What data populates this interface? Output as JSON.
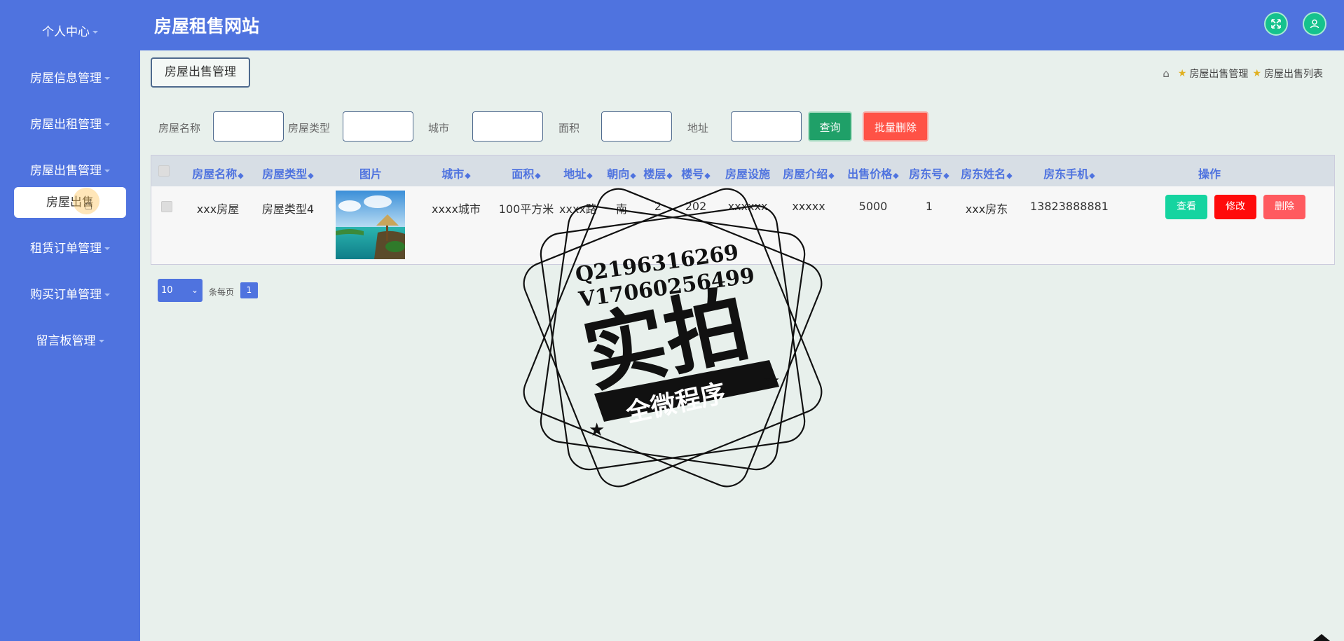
{
  "app": {
    "title": "房屋租售网站"
  },
  "sidebar": {
    "items": [
      {
        "label": "个人中心"
      },
      {
        "label": "房屋信息管理"
      },
      {
        "label": "房屋出租管理"
      },
      {
        "label": "房屋出售管理"
      },
      {
        "label": "租赁订单管理"
      },
      {
        "label": "购买订单管理"
      },
      {
        "label": "留言板管理"
      }
    ],
    "active_sub": "房屋出售"
  },
  "header": {
    "fullscreen_icon": "expand-icon",
    "user_icon": "user-icon"
  },
  "page": {
    "tab": "房屋出售管理",
    "breadcrumb": [
      "房屋出售管理",
      "房屋出售列表"
    ]
  },
  "search": {
    "fields": [
      {
        "label": "房屋名称",
        "value": ""
      },
      {
        "label": "房屋类型",
        "value": ""
      },
      {
        "label": "城市",
        "value": ""
      },
      {
        "label": "面积",
        "value": ""
      },
      {
        "label": "地址",
        "value": ""
      }
    ],
    "query_label": "查询",
    "batch_delete_label": "批量删除"
  },
  "table": {
    "columns": [
      "房屋名称",
      "房屋类型",
      "图片",
      "城市",
      "面积",
      "地址",
      "朝向",
      "楼层",
      "楼号",
      "房屋设施",
      "房屋介绍",
      "出售价格",
      "房东号",
      "房东姓名",
      "房东手机",
      "操作"
    ],
    "sortable": [
      true,
      true,
      false,
      true,
      true,
      true,
      true,
      true,
      true,
      false,
      true,
      true,
      true,
      true,
      true,
      false
    ],
    "rows": [
      {
        "cells": [
          "xxx房屋",
          "房屋类型4",
          "",
          "xxxx城市",
          "100平方米",
          "xxxx路",
          "南",
          "2",
          "202",
          "xxxxxx",
          "xxxxx",
          "5000",
          "1",
          "xxx房东",
          "13823888881"
        ],
        "actions": [
          "查看",
          "修改",
          "删除"
        ]
      }
    ]
  },
  "pagination": {
    "page_size": "10",
    "per_page_label": "条每页",
    "current_page": "1"
  },
  "watermark": {
    "line1": "Q2196316269",
    "line2": "V17060256499",
    "big": "实拍",
    "banner": "全微程序"
  },
  "colors": {
    "primary": "#4f73df",
    "success": "#15c28d",
    "danger": "#ff1f1f",
    "danger_soft": "#ff5a5f"
  }
}
